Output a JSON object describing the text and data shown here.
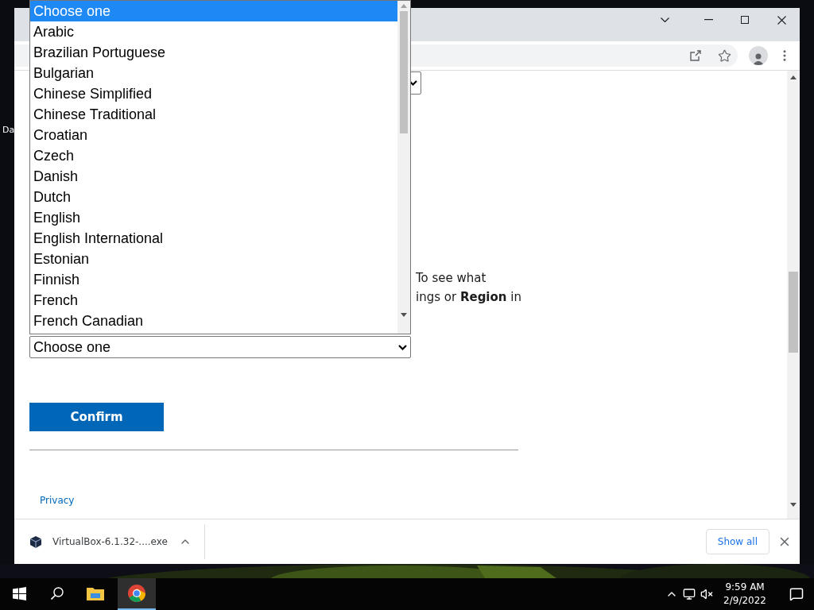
{
  "desktop": {
    "icon_label": "Da"
  },
  "dropdown": {
    "options": [
      {
        "label": "Choose one",
        "selected": true
      },
      {
        "label": "Arabic",
        "selected": false
      },
      {
        "label": "Brazilian Portuguese",
        "selected": false
      },
      {
        "label": "Bulgarian",
        "selected": false
      },
      {
        "label": "Chinese Simplified",
        "selected": false
      },
      {
        "label": "Chinese Traditional",
        "selected": false
      },
      {
        "label": "Croatian",
        "selected": false
      },
      {
        "label": "Czech",
        "selected": false
      },
      {
        "label": "Danish",
        "selected": false
      },
      {
        "label": "Dutch",
        "selected": false
      },
      {
        "label": "English",
        "selected": false
      },
      {
        "label": "English International",
        "selected": false
      },
      {
        "label": "Estonian",
        "selected": false
      },
      {
        "label": "Finnish",
        "selected": false
      },
      {
        "label": "French",
        "selected": false
      },
      {
        "label": "French Canadian",
        "selected": false
      }
    ]
  },
  "page": {
    "paragraph_lines": [
      "To see what",
      "ings or **Region** in"
    ],
    "language_select": {
      "value": "Choose one"
    },
    "confirm_button": "Confirm",
    "footer_link": "Privacy"
  },
  "download_bar": {
    "file": "VirtualBox-6.1.32-....exe",
    "show_all": "Show all"
  },
  "taskbar": {
    "apps": [
      {
        "kind": "explorer",
        "selected": false
      },
      {
        "kind": "chrome",
        "selected": true
      }
    ],
    "time": "9:59 AM",
    "date": "2/9/2022"
  }
}
